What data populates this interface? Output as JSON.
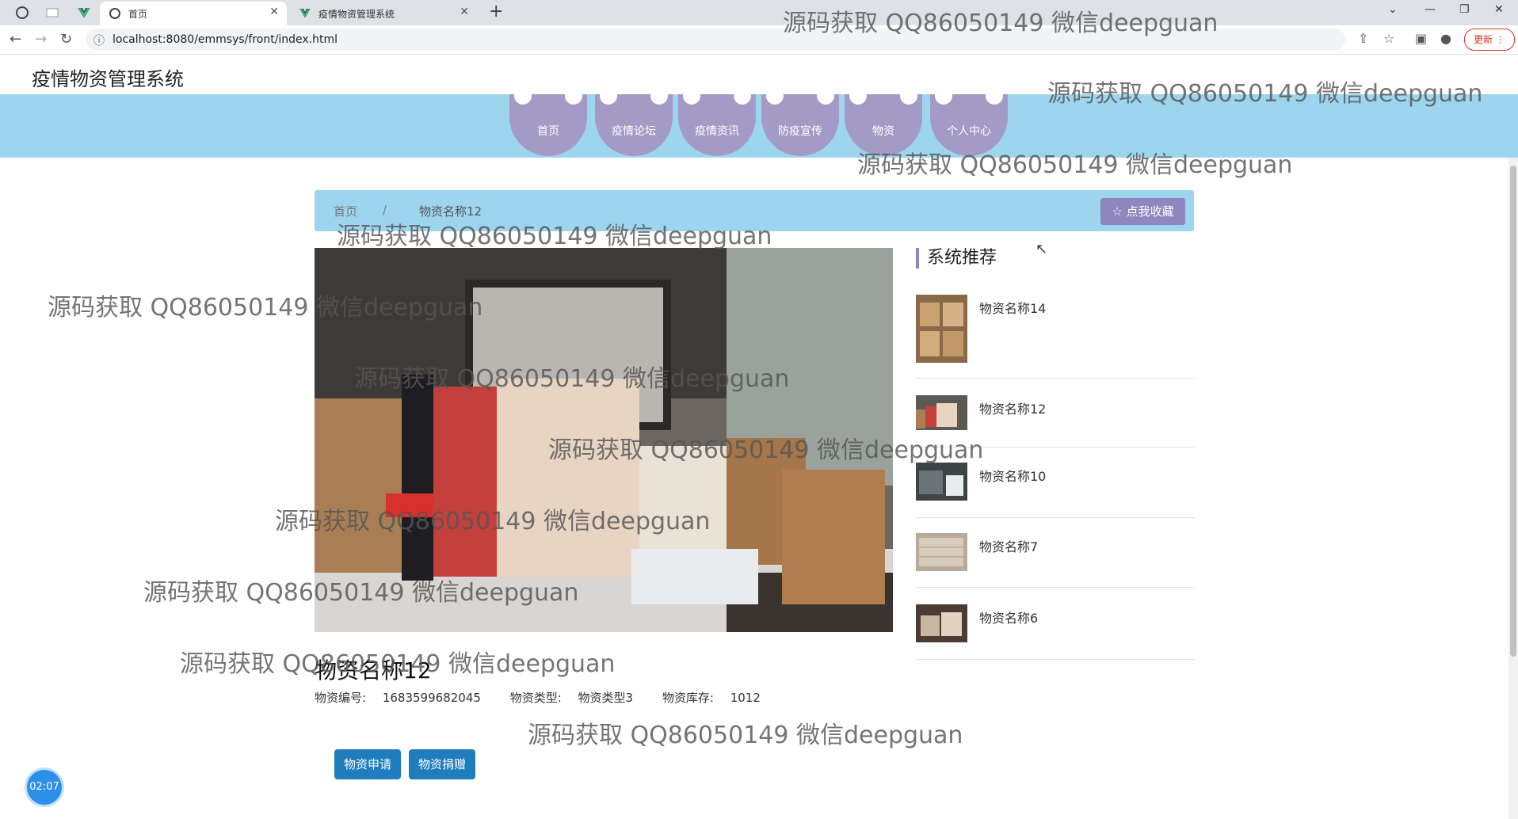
{
  "browser": {
    "tabs": [
      {
        "title": "首页",
        "active": true
      },
      {
        "title": "疫情物资管理系统",
        "active": false
      }
    ],
    "url": "localhost:8080/emmsys/front/index.html",
    "update_label": "更新"
  },
  "site": {
    "title": "疫情物资管理系统",
    "nav": [
      "首页",
      "疫情论坛",
      "疫情资讯",
      "防疫宣传",
      "物资",
      "个人中心"
    ]
  },
  "breadcrumb": {
    "home": "首页",
    "separator": "/",
    "current": "物资名称12",
    "favorite_label": "☆ 点我收藏"
  },
  "recommend": {
    "header": "系统推荐",
    "items": [
      "物资名称14",
      "物资名称12",
      "物资名称10",
      "物资名称7",
      "物资名称6"
    ]
  },
  "product": {
    "title": "物资名称12",
    "code_label": "物资编号:",
    "code_value": "1683599682045",
    "type_label": "物资类型:",
    "type_value": "物资类型3",
    "stock_label": "物资库存:",
    "stock_value": "1012",
    "apply_label": "物资申请",
    "donate_label": "物资捐赠"
  },
  "timer": "02:07",
  "watermark": "源码获取 QQ86050149 微信deepguan"
}
